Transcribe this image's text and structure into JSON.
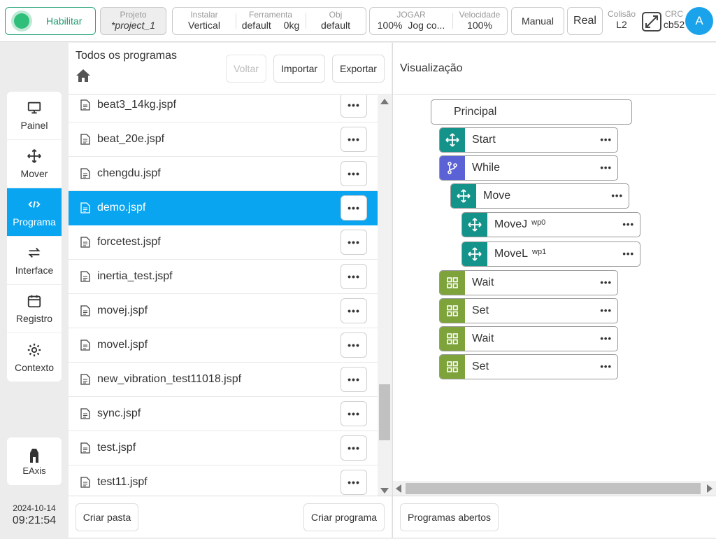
{
  "topbar": {
    "enable_label": "Habilitar",
    "projeto_caption": "Projeto",
    "projeto_value": "*project_1",
    "instalar_caption": "Instalar",
    "instalar_value": "Vertical",
    "ferramenta_caption": "Ferramenta",
    "ferramenta_value": "default",
    "ferramenta_weight": "0kg",
    "obj_caption": "Obj",
    "obj_value": "default",
    "jogar_caption": "JOGAR",
    "jogar_percent": "100%",
    "jogar_mode": "Jog co...",
    "velocidade_caption": "Velocidade",
    "velocidade_value": "100%",
    "manual_label": "Manual",
    "real_label": "Real",
    "colisao_caption": "Colisão",
    "colisao_value": "L2",
    "crc_caption": "CRC",
    "crc_value": "cb52",
    "avatar_letter": "A"
  },
  "sidebar": {
    "items": [
      {
        "label": "Painel",
        "icon": "monitor-icon"
      },
      {
        "label": "Mover",
        "icon": "move-arrows-icon"
      },
      {
        "label": "Programa",
        "icon": "code-icon"
      },
      {
        "label": "Interface",
        "icon": "swap-arrows-icon"
      },
      {
        "label": "Registro",
        "icon": "calendar-icon"
      },
      {
        "label": "Contexto",
        "icon": "gear-icon"
      }
    ],
    "active_index": 2,
    "eaxis_label": "EAxis",
    "date": "2024-10-14",
    "time": "09:21:54"
  },
  "program_list": {
    "title": "Todos os programas",
    "back_label": "Voltar",
    "import_label": "Importar",
    "export_label": "Exportar",
    "files": [
      "beat3_14kg.jspf",
      "beat_20e.jspf",
      "chengdu.jspf",
      "demo.jspf",
      "forcetest.jspf",
      "inertia_test.jspf",
      "movej.jspf",
      "movel.jspf",
      "new_vibration_test11018.jspf",
      "sync.jspf",
      "test.jspf",
      "test11.jspf"
    ],
    "selected_file": "demo.jspf",
    "create_folder_label": "Criar pasta",
    "create_program_label": "Criar programa"
  },
  "visualization": {
    "title": "Visualização",
    "root_label": "Principal",
    "nodes": [
      {
        "label": "Start",
        "sub": "",
        "color": "#13938a",
        "icon": "move-arrows-icon"
      },
      {
        "label": "While",
        "sub": "",
        "color": "#5b62d6",
        "icon": "branch-icon"
      },
      {
        "label": "Move",
        "sub": "",
        "color": "#13938a",
        "icon": "move-arrows-icon"
      },
      {
        "label": "MoveJ",
        "sub": "wp0",
        "color": "#13938a",
        "icon": "move-arrows-icon"
      },
      {
        "label": "MoveL",
        "sub": "wp1",
        "color": "#13938a",
        "icon": "move-arrows-icon"
      },
      {
        "label": "Wait",
        "sub": "",
        "color": "#7da33a",
        "icon": "grid-icon"
      },
      {
        "label": "Set",
        "sub": "",
        "color": "#7da33a",
        "icon": "grid-icon"
      },
      {
        "label": "Wait",
        "sub": "",
        "color": "#7da33a",
        "icon": "grid-icon"
      },
      {
        "label": "Set",
        "sub": "",
        "color": "#7da33a",
        "icon": "grid-icon"
      }
    ],
    "open_programs_label": "Programas abertos"
  }
}
